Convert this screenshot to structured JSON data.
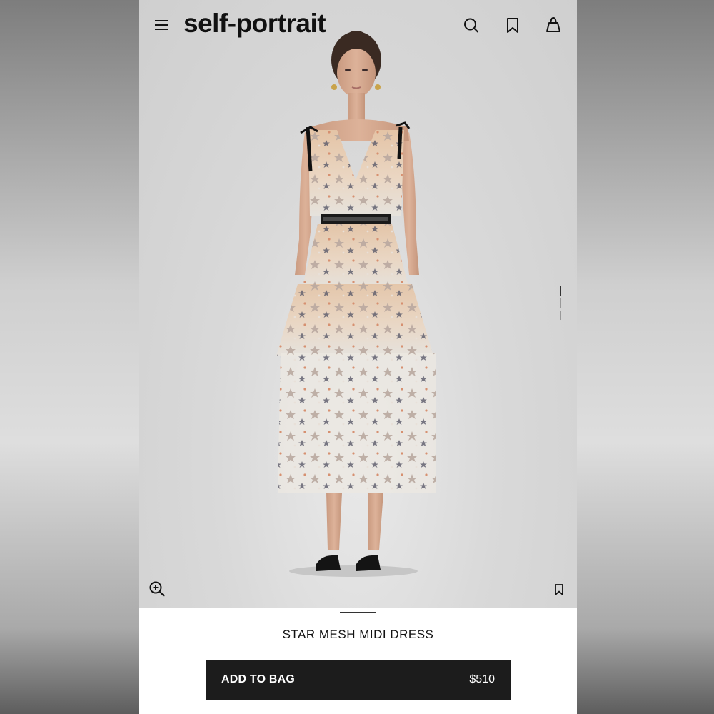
{
  "brand": {
    "logo_text": "self-portrait"
  },
  "header": {
    "icons": [
      "menu-icon",
      "search-icon",
      "bookmark-icon",
      "bag-icon"
    ]
  },
  "gallery": {
    "image_description": "model wearing star mesh midi dress",
    "image_count_indicator": 3,
    "active_image": 1
  },
  "product": {
    "name": "STAR MESH MIDI DRESS",
    "add_to_bag_label": "ADD TO BAG",
    "price": "$510"
  },
  "colors": {
    "button_bg": "#1c1c1c",
    "button_text": "#ffffff",
    "hero_bg": "#d9d9d9",
    "dress_base": "#e6c8ac"
  }
}
